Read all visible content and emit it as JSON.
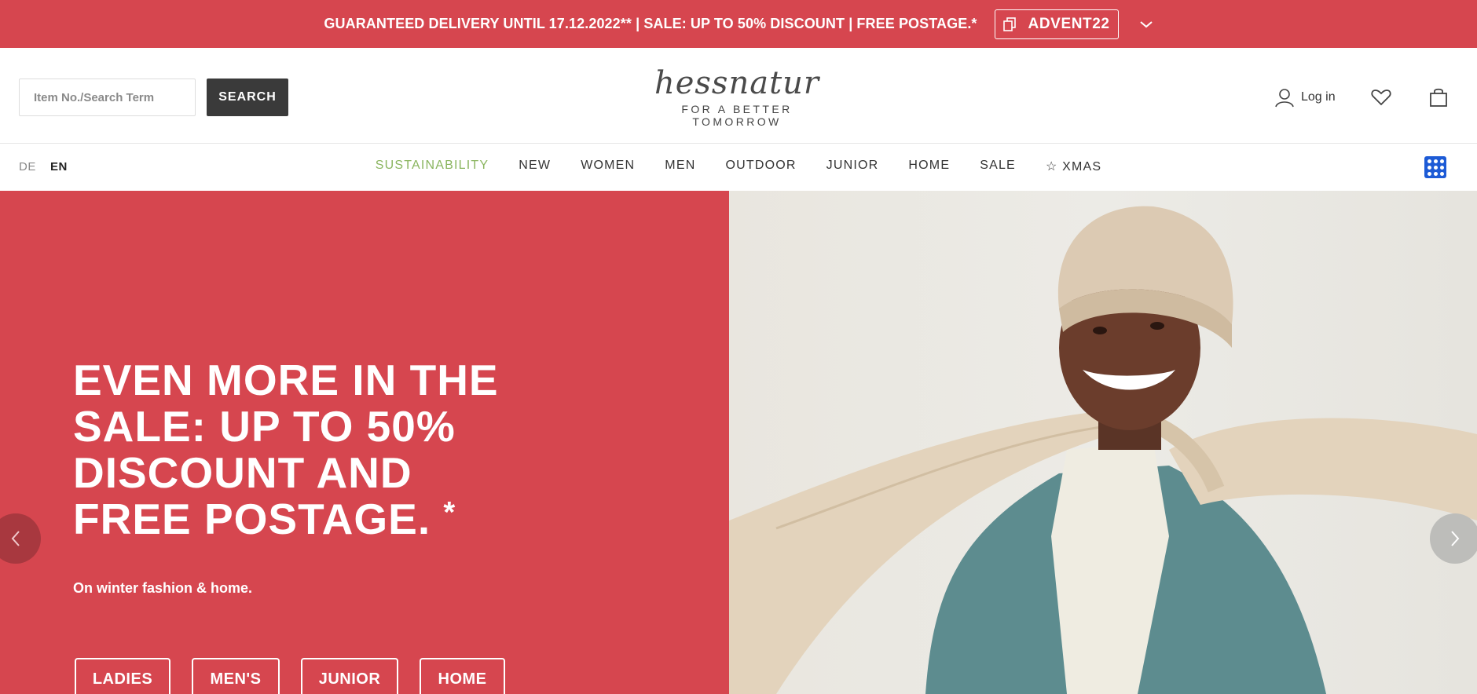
{
  "promo": {
    "text": "GUARANTEED DELIVERY UNTIL 17.12.2022** | SALE: UP TO 50% DISCOUNT | FREE POSTAGE.*",
    "code": "ADVENT22"
  },
  "header": {
    "search_placeholder": "Item No./Search Term",
    "search_button": "SEARCH",
    "logo_word": "hessnatur",
    "logo_tagline": "FOR A BETTER TOMORROW",
    "login": "Log in"
  },
  "nav": {
    "lang_de": "DE",
    "lang_en": "EN",
    "items": [
      "SUSTAINABILITY",
      "NEW",
      "WOMEN",
      "MEN",
      "OUTDOOR",
      "JUNIOR",
      "HOME",
      "SALE",
      "☆ XMAS"
    ]
  },
  "hero": {
    "headline": "EVEN MORE IN THE SALE: UP TO 50% DISCOUNT AND FREE POSTAGE.",
    "headline_mark": "*",
    "subline": "On winter fashion & home.",
    "buttons": [
      "LADIES",
      "MEN'S",
      "JUNIOR",
      "HOME"
    ]
  },
  "colors": {
    "brand_red": "#d6464f",
    "sustainability_green": "#8ab55f",
    "search_button_bg": "#3a3a3a"
  }
}
